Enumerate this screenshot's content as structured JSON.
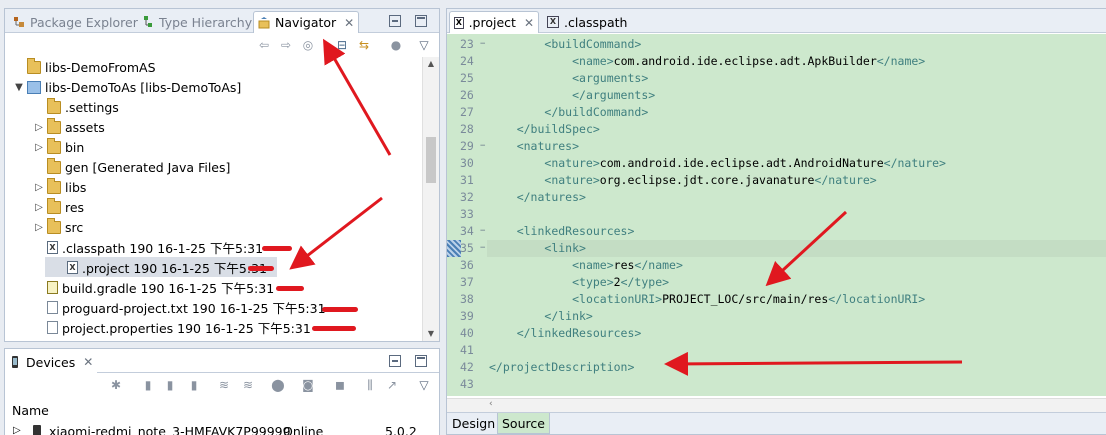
{
  "explorer": {
    "tabs": [
      {
        "label": "Package Explorer",
        "icon": "package-explorer-icon"
      },
      {
        "label": "Type Hierarchy",
        "icon": "type-hierarchy-icon"
      },
      {
        "label": "Navigator",
        "icon": "navigator-icon"
      }
    ],
    "tree": [
      {
        "label": "libs-DemoFromAS",
        "icon": "folder",
        "indent": 0,
        "arrow": ""
      },
      {
        "label": "libs-DemoToAs [libs-DemoToAs]",
        "icon": "project",
        "indent": 0,
        "arrow": "▼"
      },
      {
        "label": ".settings",
        "icon": "folder",
        "indent": 1,
        "arrow": ""
      },
      {
        "label": "assets",
        "icon": "folder",
        "indent": 1,
        "arrow": "▷"
      },
      {
        "label": "bin",
        "icon": "folder",
        "indent": 1,
        "arrow": "▷"
      },
      {
        "label": "gen [Generated Java Files]",
        "icon": "folder",
        "indent": 1,
        "arrow": ""
      },
      {
        "label": "libs",
        "icon": "folder",
        "indent": 1,
        "arrow": "▷"
      },
      {
        "label": "res",
        "icon": "folder",
        "indent": 1,
        "arrow": "▷"
      },
      {
        "label": "src",
        "icon": "folder",
        "indent": 1,
        "arrow": "▷"
      },
      {
        "label": ".classpath 190  16-1-25 下午5:31",
        "icon": "xfile",
        "indent": 1,
        "arrow": ""
      },
      {
        "label": ".project 190  16-1-25 下午5:31",
        "icon": "xfile",
        "indent": 1,
        "arrow": "",
        "selected": true
      },
      {
        "label": "build.gradle 190  16-1-25 下午5:31",
        "icon": "gfile",
        "indent": 1,
        "arrow": ""
      },
      {
        "label": "proguard-project.txt 190  16-1-25 下午5:31",
        "icon": "file",
        "indent": 1,
        "arrow": ""
      },
      {
        "label": "project.properties 190  16-1-25 下午5:31",
        "icon": "file",
        "indent": 1,
        "arrow": ""
      }
    ]
  },
  "devices": {
    "tab_label": "Devices",
    "column_name": "Name",
    "row": {
      "name": "xiaomi-redmi_note_3-HMFAVK7P99999",
      "status": "Online",
      "version": "5.0.2"
    }
  },
  "editor": {
    "tabs": [
      {
        "label": ".project",
        "icon": "xml-file-icon"
      },
      {
        "label": ".classpath",
        "icon": "xml-file-icon"
      }
    ],
    "bottom_tabs": {
      "design": "Design",
      "source": "Source"
    },
    "current_line": 35,
    "lines": [
      {
        "n": "23",
        "fold": true,
        "indent": "        ",
        "tag": "<buildCommand>",
        "text": "",
        "close": ""
      },
      {
        "n": "24",
        "fold": false,
        "indent": "            ",
        "tag": "<name>",
        "text": "com.android.ide.eclipse.adt.ApkBuilder",
        "close": "</name>"
      },
      {
        "n": "25",
        "fold": false,
        "indent": "            ",
        "tag": "<arguments>",
        "text": "",
        "close": ""
      },
      {
        "n": "26",
        "fold": false,
        "indent": "            ",
        "tag": "</arguments>",
        "text": "",
        "close": ""
      },
      {
        "n": "27",
        "fold": false,
        "indent": "        ",
        "tag": "</buildCommand>",
        "text": "",
        "close": ""
      },
      {
        "n": "28",
        "fold": false,
        "indent": "    ",
        "tag": "</buildSpec>",
        "text": "",
        "close": ""
      },
      {
        "n": "29",
        "fold": true,
        "indent": "    ",
        "tag": "<natures>",
        "text": "",
        "close": ""
      },
      {
        "n": "30",
        "fold": false,
        "indent": "        ",
        "tag": "<nature>",
        "text": "com.android.ide.eclipse.adt.AndroidNature",
        "close": "</nature>"
      },
      {
        "n": "31",
        "fold": false,
        "indent": "        ",
        "tag": "<nature>",
        "text": "org.eclipse.jdt.core.javanature",
        "close": "</nature>"
      },
      {
        "n": "32",
        "fold": false,
        "indent": "    ",
        "tag": "</natures>",
        "text": "",
        "close": ""
      },
      {
        "n": "33",
        "fold": false,
        "indent": "",
        "tag": "",
        "text": "",
        "close": ""
      },
      {
        "n": "34",
        "fold": true,
        "indent": "    ",
        "tag": "<linkedResources>",
        "text": "",
        "close": ""
      },
      {
        "n": "35",
        "fold": true,
        "indent": "        ",
        "tag": "<link>",
        "text": "",
        "close": ""
      },
      {
        "n": "36",
        "fold": false,
        "indent": "            ",
        "tag": "<name>",
        "text": "res",
        "close": "</name>"
      },
      {
        "n": "37",
        "fold": false,
        "indent": "            ",
        "tag": "<type>",
        "text": "2",
        "close": "</type>"
      },
      {
        "n": "38",
        "fold": false,
        "indent": "            ",
        "tag": "<locationURI>",
        "text": "PROJECT_LOC/src/main/res",
        "close": "</locationURI>"
      },
      {
        "n": "39",
        "fold": false,
        "indent": "        ",
        "tag": "</link>",
        "text": "",
        "close": ""
      },
      {
        "n": "40",
        "fold": false,
        "indent": "    ",
        "tag": "</linkedResources>",
        "text": "",
        "close": ""
      },
      {
        "n": "41",
        "fold": false,
        "indent": "",
        "tag": "",
        "text": "",
        "close": ""
      },
      {
        "n": "42",
        "fold": false,
        "indent": "",
        "tag": "</projectDescription>",
        "text": "",
        "close": ""
      },
      {
        "n": "43",
        "fold": false,
        "indent": "",
        "tag": "",
        "text": "",
        "close": ""
      }
    ]
  },
  "colors": {
    "annotation_red": "#e0181f",
    "editor_bg": "#cde8cd",
    "xml_tag": "#3f7f7f"
  }
}
